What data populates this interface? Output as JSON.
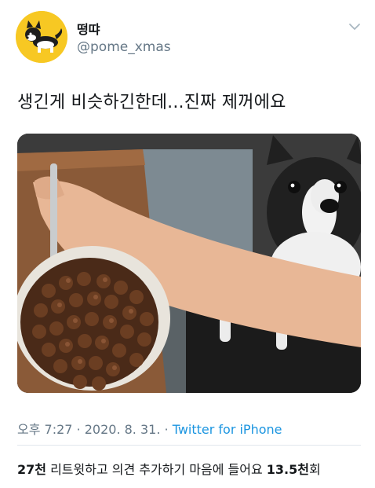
{
  "user": {
    "display_name": "떵땨",
    "handle": "@pome_xmas"
  },
  "tweet": {
    "text": "생긴게 비슷하긴한데...진짜 제꺼에요"
  },
  "meta": {
    "time": "오후 7:27",
    "sep1": " · ",
    "date": "2020. 8. 31.",
    "sep2": " · ",
    "source": "Twitter for iPhone"
  },
  "stats": {
    "retweets_count": "27천",
    "retweets_label": " 리트윗하고 의견 추가하기",
    "likes_label": "  마음에 들어요 ",
    "likes_count": "13.5천",
    "likes_suffix": "회"
  },
  "colors": {
    "link": "#1b95e0",
    "muted": "#657786",
    "avatar_bg": "#f7c823"
  },
  "icons": {
    "avatar": "dog-cartoon-icon",
    "menu": "chevron-down-icon"
  }
}
